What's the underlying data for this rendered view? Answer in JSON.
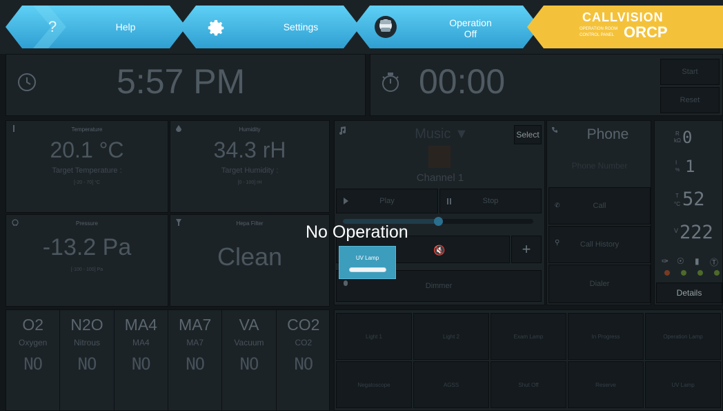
{
  "nav": {
    "help_label": "Help",
    "settings_label": "Settings",
    "operation_label_1": "Operation",
    "operation_label_2": "Off",
    "logo_top": "CALLVISION",
    "logo_sub1": "OPERATION ROOM",
    "logo_sub2": "CONTROL PANEL",
    "logo_big": "ORCP",
    "help_glyph": "?"
  },
  "clock": {
    "time": "5:57 PM"
  },
  "timer": {
    "value": "00:00",
    "start_label": "Start",
    "reset_label": "Reset"
  },
  "environment": {
    "temperature": {
      "title": "Temperature",
      "value": "20.1 °C",
      "target_label": "Target Temperature :",
      "range": "[-20 - 70] °C"
    },
    "humidity": {
      "title": "Humidity",
      "value": "34.3 rH",
      "target_label": "Target Humidity :",
      "range": "[0 - 100] rH"
    },
    "pressure": {
      "title": "Pressure",
      "value": "-13.2 Pa",
      "range": "[-100 - 100] Pa"
    },
    "hepa": {
      "title": "Hepa Filter",
      "value": "Clean"
    }
  },
  "music": {
    "title": "Music ▼",
    "select_label": "Select",
    "channel": "Channel 1",
    "play_label": "Play",
    "stop_label": "Stop",
    "dimmer_label": "Dimmer",
    "plus_label": "+"
  },
  "phone": {
    "title": "Phone",
    "call_label": "Call",
    "history_label": "Call History",
    "dialer_label": "Dialer",
    "number_placeholder": "Phone Number"
  },
  "status": {
    "rh_value": "0",
    "k_value": "1",
    "tc_value": "52",
    "v_value": "222",
    "details_label": "Details",
    "r_label": "R",
    "k_label": "kΩ",
    "i_label": "I",
    "pct_label": "%",
    "t_label": "T",
    "c_label": "°C",
    "v_label": "V"
  },
  "gases": [
    {
      "code": "O2",
      "name": "Oxygen",
      "state": "NO"
    },
    {
      "code": "N2O",
      "name": "Nitrous",
      "state": "NO"
    },
    {
      "code": "MA4",
      "name": "MA4",
      "state": "NO"
    },
    {
      "code": "MA7",
      "name": "MA7",
      "state": "NO"
    },
    {
      "code": "VA",
      "name": "Vacuum",
      "state": "NO"
    },
    {
      "code": "CO2",
      "name": "CO2",
      "state": "NO"
    }
  ],
  "lights": [
    "Light 1",
    "Light 2",
    "Exam Lamp",
    "In Progress",
    "Operation Lamp",
    "Negatoscope",
    "AGSS",
    "Shut Off",
    "Reserve",
    "UV Lamp"
  ],
  "overlay": {
    "message": "No Operation",
    "uv_lamp_label": "UV Lamp"
  },
  "colors": {
    "nav_blue": "#44b6e4",
    "logo_yellow": "#f4c23a",
    "uv_button": "#3c9dbd"
  }
}
